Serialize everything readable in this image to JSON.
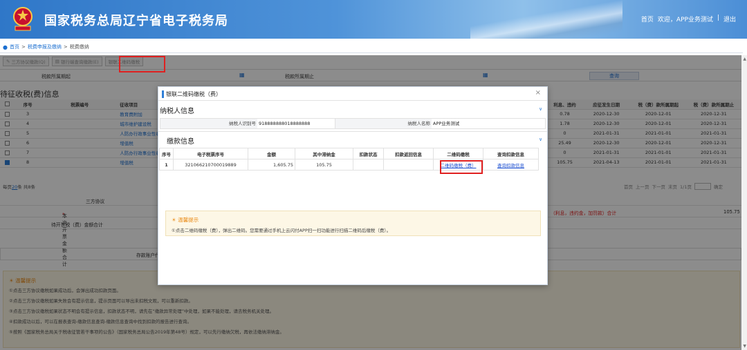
{
  "header": {
    "title": "国家税务总局辽宁省电子税务局",
    "links": [
      "首页",
      "欢迎，APP业务测试",
      "|",
      "退出"
    ]
  },
  "breadcrumb": [
    "首页",
    ">",
    "税费申报及缴纳",
    ">",
    "税费缴纳"
  ],
  "toolbar": [
    "三方协议缴款(Q)",
    "银行端查询缴款(E)",
    "银联二维码缴税"
  ],
  "filter": {
    "start_label": "税款所属期起",
    "end_label": "税款所属期止",
    "query_label": "查询"
  },
  "pending": {
    "title": "待征收税(费)信息",
    "columns": [
      "",
      "序号",
      "税票编号",
      "征收项目",
      "利息、违约",
      "应征发生日期",
      "税（费）款所属期起",
      "税（费）款所属期止"
    ],
    "rows": [
      {
        "no": "3",
        "item": "教育费附加",
        "late": "0.78",
        "date": "2020-12-30",
        "start": "2020-12-01",
        "end": "2020-12-31",
        "checked": false
      },
      {
        "no": "4",
        "item": "城市维护建设税",
        "late": "1.78",
        "date": "2020-12-30",
        "start": "2020-12-01",
        "end": "2020-12-31",
        "checked": false
      },
      {
        "no": "5",
        "item": "人防办行政事业性收费",
        "late": "0",
        "date": "2021-01-31",
        "start": "2021-01-01",
        "end": "2021-01-31",
        "checked": false
      },
      {
        "no": "6",
        "item": "增值税",
        "late": "25.49",
        "date": "2020-12-30",
        "start": "2020-12-01",
        "end": "2020-12-31",
        "checked": false
      },
      {
        "no": "7",
        "item": "人防办行政事业性收费",
        "late": "0",
        "date": "2021-01-31",
        "start": "2021-01-01",
        "end": "2021-01-31",
        "checked": false
      },
      {
        "no": "8",
        "item": "增值税",
        "late": "105.75",
        "date": "2021-04-13",
        "start": "2021-01-01",
        "end": "2021-01-31",
        "checked": true
      }
    ],
    "pager_left": [
      "每页",
      "20",
      "条 共8条"
    ],
    "pager_right": [
      "首页",
      "上一页",
      "下一页",
      "末页",
      "1/1页",
      "确定"
    ]
  },
  "summary": {
    "agreement": "三方协议",
    "selected_total": "本次开票金额合计",
    "pending_total": "待开票税（费）金额合计",
    "interest_total": "（利息，违约金，加罚款）合计",
    "interest_value": "105.75",
    "deposit": "存款账户代"
  },
  "bottom_tips": {
    "title": "温馨提示",
    "lines": [
      "①点击三方协议缴税如果成功后，会弹出成功扣款页面。",
      "②点击三方协议缴税如果失败会有提示信息，提示页面可以导出未扣税文观，可以重新扣款。",
      "③点击三方协议缴税如果状态不明会有提示信息，扣款状态不明，请先在“缴款异常处理”中处理，如果不能处理，请去税务机关处理。",
      "④扣款成功以后，可以在报表查询-缴款信息查询-缴款信息查询中找到扣款的报告进行查询。",
      "⑤按照《国家税务总局关于税收征管若干事项的公告》（国家税务总局公告2019年第48号）规定，可以先行缴纳欠税，再依法缴纳滞纳金。"
    ]
  },
  "modal": {
    "title": "银联二维码缴税（费）",
    "close": "×",
    "taxpayer_section": "纳税人信息",
    "tin_label": "纳税人识别号",
    "tin_value": "918888888018888888",
    "name_label": "纳税人名称",
    "name_value": "APP业务测试",
    "payment_section": "缴款信息",
    "columns": [
      "序号",
      "电子税票序号",
      "金额",
      "其中滞纳金",
      "扣款状态",
      "扣款返回信息",
      "二维码缴税",
      "查询扣款信息"
    ],
    "row": {
      "no": "1",
      "ticket": "321066210700019889",
      "amount": "1,605.75",
      "late_fee": "105.75",
      "status": "",
      "return_info": "",
      "qr_link": "二维码缴税（费）",
      "query_link": "查询扣款信息"
    },
    "tip_title": "温馨提示",
    "tip_text": "①点击二维码缴税（费），弹出二维码。您需要通过手机上云闪付APP扫一扫功能进行扫描二维码后缴税（费）。"
  }
}
